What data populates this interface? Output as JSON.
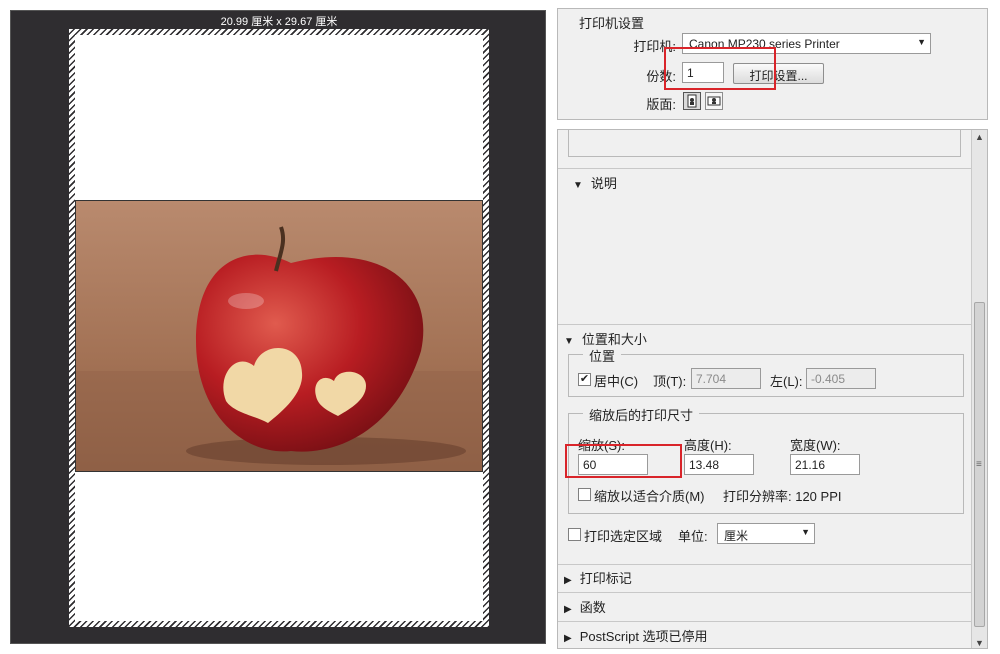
{
  "preview": {
    "page_size": "20.99 厘米 x 29.67 厘米"
  },
  "printer_panel": {
    "title": "打印机设置",
    "printer_label": "打印机:",
    "printer_value": "Canon MP230 series Printer",
    "copies_label": "份数:",
    "copies_value": "1",
    "print_settings_button": "打印设置...",
    "layout_label": "版面:"
  },
  "description": {
    "header": "说明"
  },
  "position_size": {
    "header": "位置和大小",
    "position_group": "位置",
    "center_label": "居中(C)",
    "center_checked": true,
    "top_label": "顶(T):",
    "top_value": "7.704",
    "left_label": "左(L):",
    "left_value": "-0.405",
    "scaled_group": "缩放后的打印尺寸",
    "scale_label": "缩放(S):",
    "scale_value": "60",
    "height_label": "高度(H):",
    "height_value": "13.48",
    "width_label": "宽度(W):",
    "width_value": "21.16",
    "fit_media_label": "缩放以适合介质(M)",
    "fit_media_checked": false,
    "resolution_text": "打印分辨率: 120 PPI"
  },
  "print_selected": {
    "label": "打印选定区域",
    "checked": false,
    "unit_label": "单位:",
    "unit_value": "厘米"
  },
  "collapsed_sections": {
    "print_marks": "打印标记",
    "functions": "函数",
    "postscript": "PostScript 选项已停用"
  },
  "colors": {
    "preview_bg": "#2f2d30",
    "panel_bg": "#f0f0f0",
    "highlight_red": "#d9242a"
  }
}
